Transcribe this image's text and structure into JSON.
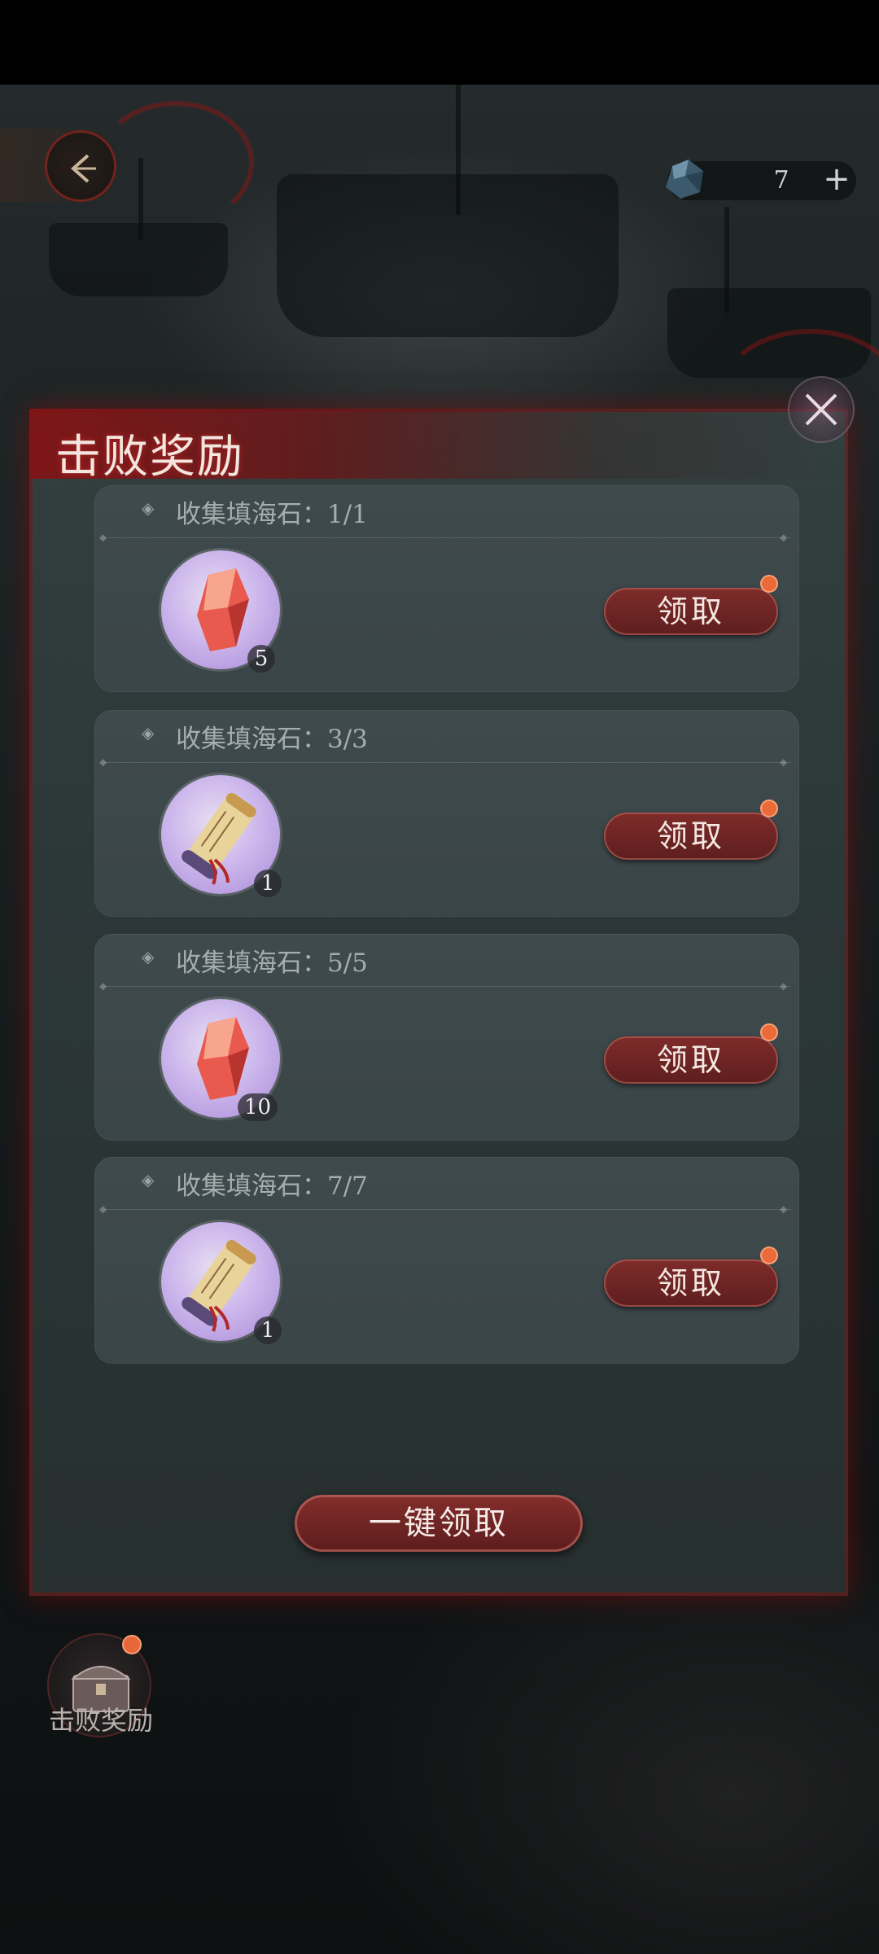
{
  "currency": {
    "icon": "sea-stone-icon",
    "value": "7",
    "plus": "+"
  },
  "panel": {
    "title": "击败奖励"
  },
  "rewards": [
    {
      "label": "收集填海石：1/1",
      "item_icon": "red-crystal-icon",
      "count": "5",
      "button": "领取"
    },
    {
      "label": "收集填海石：3/3",
      "item_icon": "scroll-icon",
      "count": "1",
      "button": "领取"
    },
    {
      "label": "收集填海石：5/5",
      "item_icon": "red-crystal-icon",
      "count": "10",
      "button": "领取"
    },
    {
      "label": "收集填海石：7/7",
      "item_icon": "scroll-icon",
      "count": "1",
      "button": "领取"
    }
  ],
  "claim_all": "一键领取",
  "bottom": {
    "label": "击败奖励"
  },
  "colors": {
    "accent_red": "#7e2c2a",
    "notify_dot": "#ec6a3a",
    "panel_bg": "#2c3738"
  }
}
